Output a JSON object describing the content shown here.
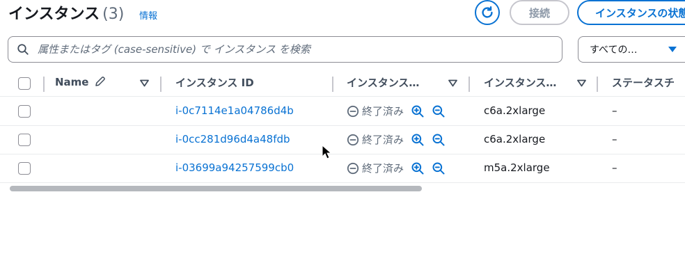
{
  "header": {
    "title": "インスタンス",
    "count": "(3)",
    "info_link": "情報",
    "connect_label": "接続",
    "state_label": "インスタンスの状態"
  },
  "search": {
    "placeholder": "属性またはタグ (case-sensitive) で インスタンス を検索"
  },
  "filter": {
    "selected": "すべての…"
  },
  "table": {
    "columns": [
      "Name",
      "インスタンス ID",
      "インスタンス…",
      "インスタンス…",
      "ステータスチ"
    ],
    "rows": [
      {
        "name": "",
        "id": "i-0c7114e1a04786d4b",
        "state": "終了済み",
        "type": "c6a.2xlarge",
        "status": "–"
      },
      {
        "name": "",
        "id": "i-0cc281d96d4a48fdb",
        "state": "終了済み",
        "type": "c6a.2xlarge",
        "status": "–"
      },
      {
        "name": "",
        "id": "i-03699a94257599cb0",
        "state": "終了済み",
        "type": "m5a.2xlarge",
        "status": "–"
      }
    ]
  },
  "colors": {
    "accent": "#0972d3",
    "text": "#16191f",
    "muted": "#5f6b7a"
  },
  "icons": {
    "refresh": "refresh-icon",
    "search": "search-icon",
    "edit": "pencil-icon",
    "sort": "sort-down-icon",
    "state": "stopped-circle-icon",
    "zoom_in": "zoom-in-icon",
    "zoom_out": "zoom-out-icon",
    "caret": "caret-down-icon"
  }
}
